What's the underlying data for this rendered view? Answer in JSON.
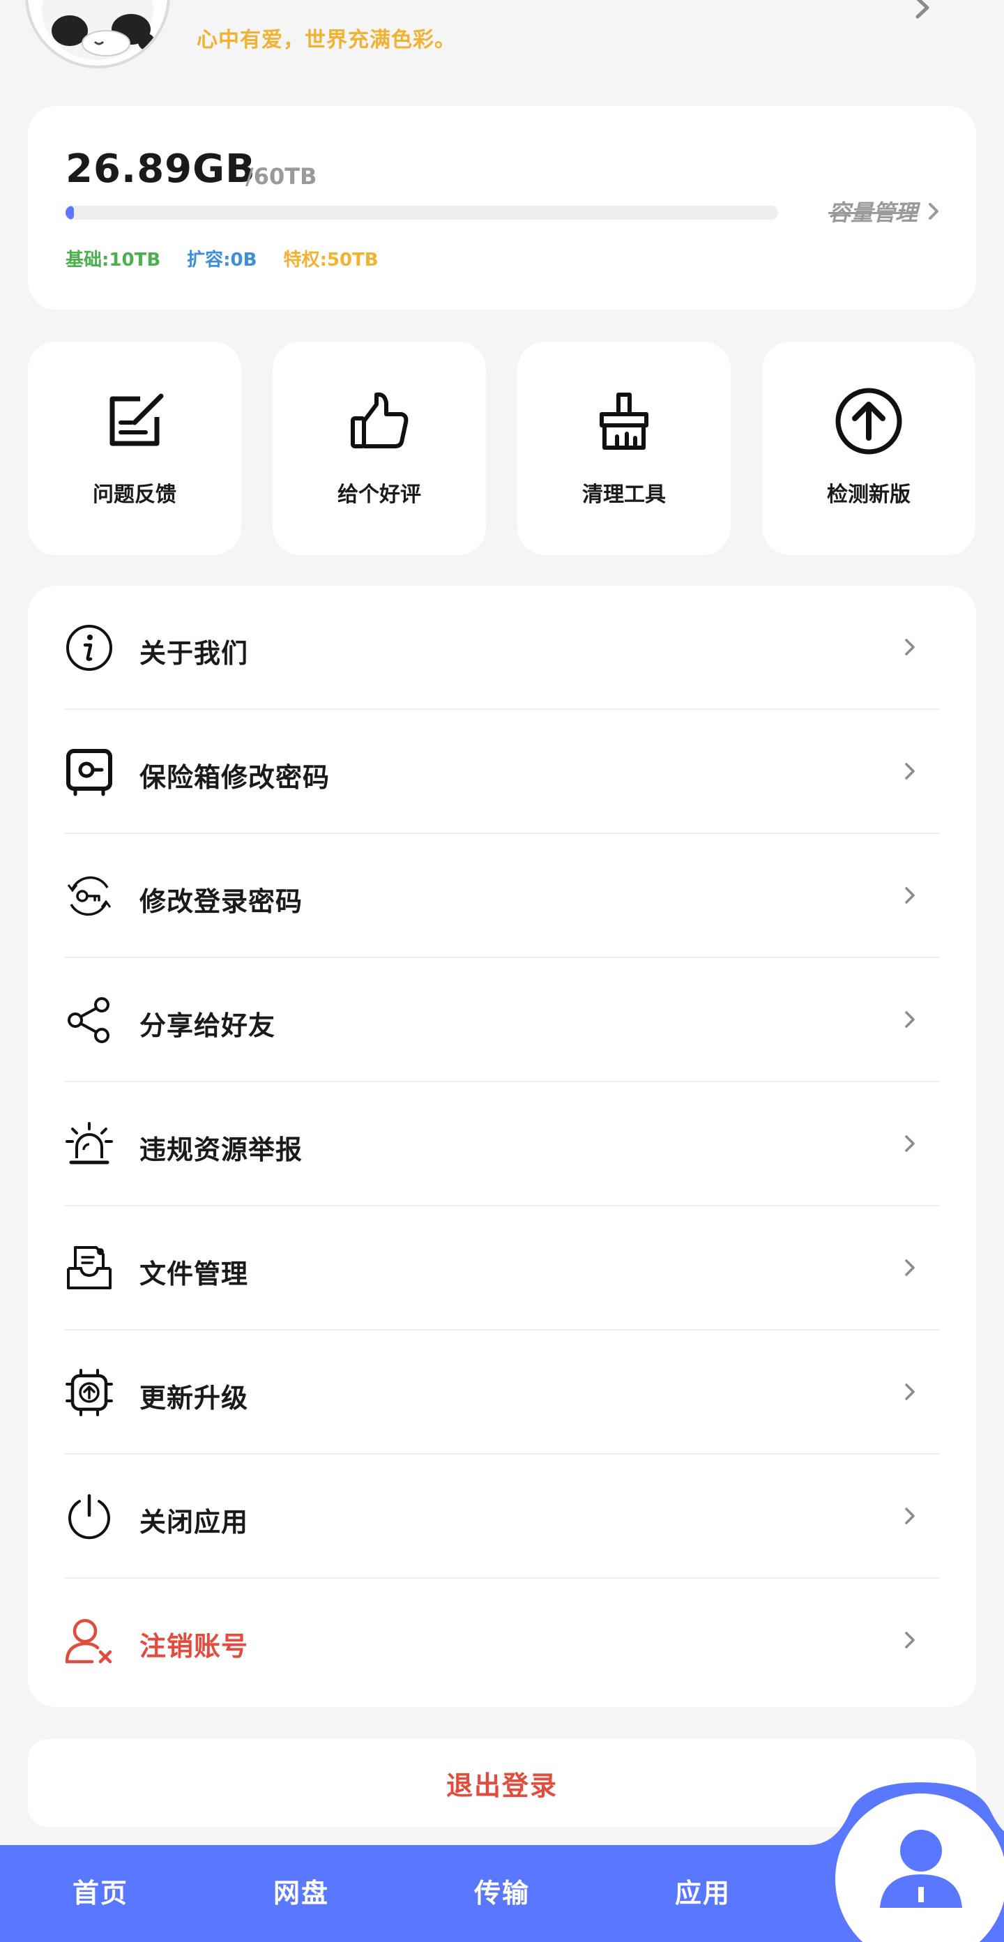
{
  "header": {
    "motto": "心中有爱，世界充满色彩。"
  },
  "storage": {
    "used": "26.89GB",
    "total": "/60TB",
    "usage_fraction": 0.0004,
    "capacity_link": "容量管理",
    "quotas": [
      {
        "label": "基础:10TB",
        "color": "#4caf50"
      },
      {
        "label": "扩容:0B",
        "color": "#3d8fd9"
      },
      {
        "label": "特权:50TB",
        "color": "#f0b233"
      }
    ]
  },
  "quick_actions": [
    {
      "label": "问题反馈",
      "icon": "feedback-edit-icon"
    },
    {
      "label": "给个好评",
      "icon": "thumbs-up-icon"
    },
    {
      "label": "清理工具",
      "icon": "broom-icon"
    },
    {
      "label": "检测新版",
      "icon": "upload-arrow-circle-icon"
    }
  ],
  "menu": [
    {
      "label": "关于我们",
      "icon": "info-icon"
    },
    {
      "label": "保险箱修改密码",
      "icon": "safe-icon"
    },
    {
      "label": "修改登录密码",
      "icon": "key-rotate-icon"
    },
    {
      "label": "分享给好友",
      "icon": "share-icon"
    },
    {
      "label": "违规资源举报",
      "icon": "alarm-light-icon"
    },
    {
      "label": "文件管理",
      "icon": "file-inbox-icon"
    },
    {
      "label": "更新升级",
      "icon": "chip-upgrade-icon"
    },
    {
      "label": "关闭应用",
      "icon": "power-icon"
    },
    {
      "label": "注销账号",
      "icon": "user-remove-icon",
      "danger": true
    }
  ],
  "logout_label": "退出登录",
  "bottom_nav": {
    "tabs": [
      "首页",
      "网盘",
      "传输",
      "应用"
    ],
    "profile_icon": "user-icon"
  },
  "colors": {
    "accent": "#5a78ff",
    "danger": "#e34b3d",
    "motto": "#f0b233"
  }
}
